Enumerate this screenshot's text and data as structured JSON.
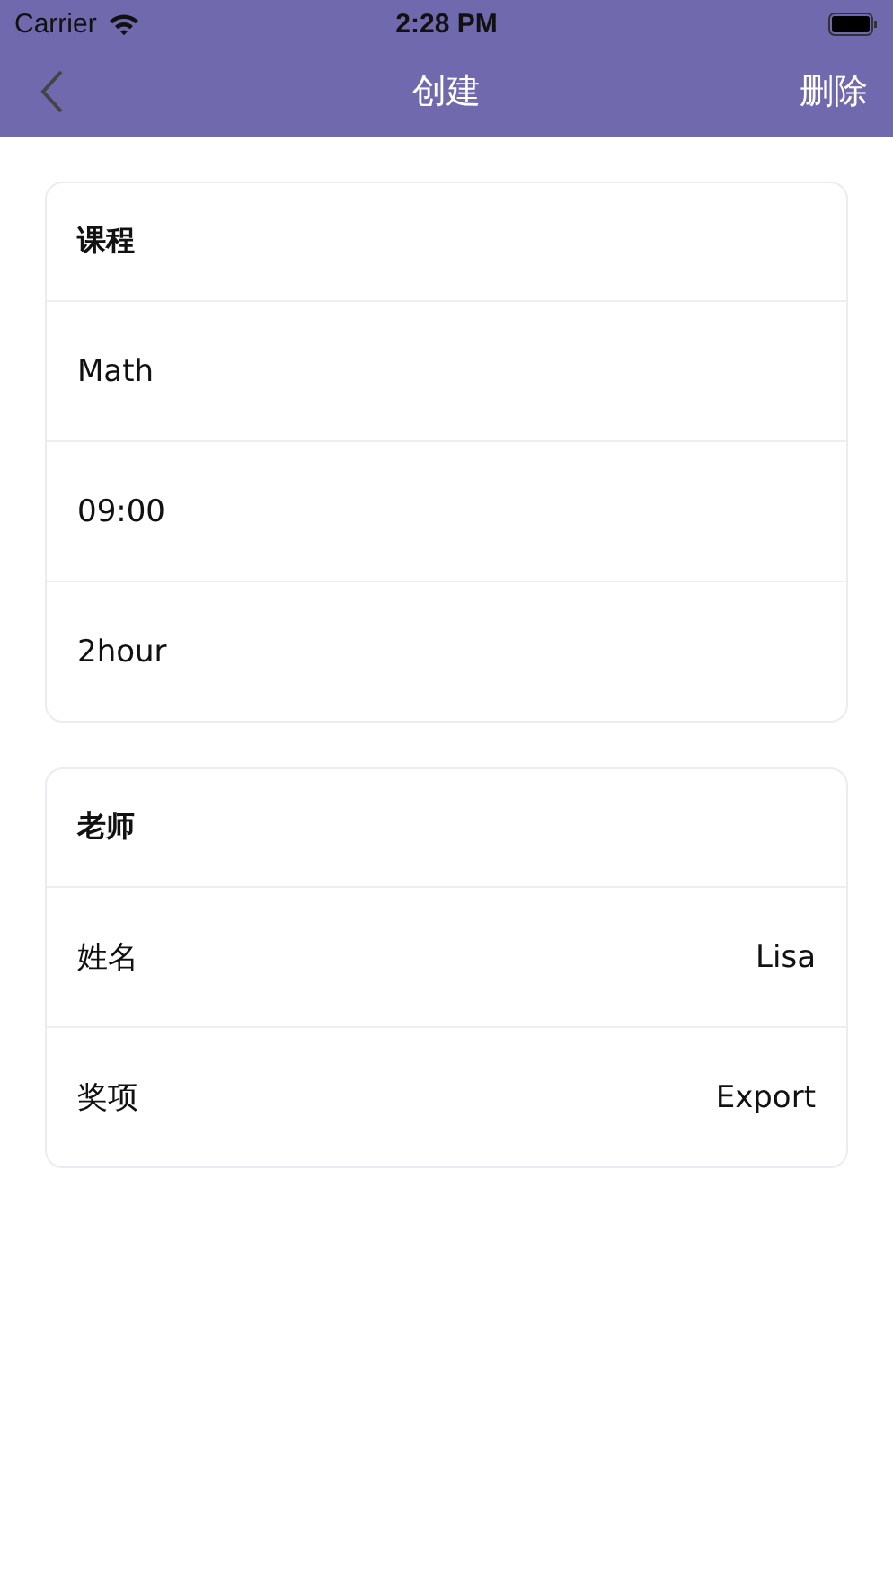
{
  "status_bar": {
    "carrier": "Carrier",
    "time": "2:28 PM"
  },
  "nav": {
    "title": "创建",
    "action": "删除"
  },
  "cards": [
    {
      "title": "课程",
      "rows": [
        {
          "label": "Math"
        },
        {
          "label": "09:00"
        },
        {
          "label": "2hour"
        }
      ]
    },
    {
      "title": "老师",
      "rows": [
        {
          "label": "姓名",
          "value": "Lisa"
        },
        {
          "label": "奖项",
          "value": "Export"
        }
      ]
    }
  ]
}
